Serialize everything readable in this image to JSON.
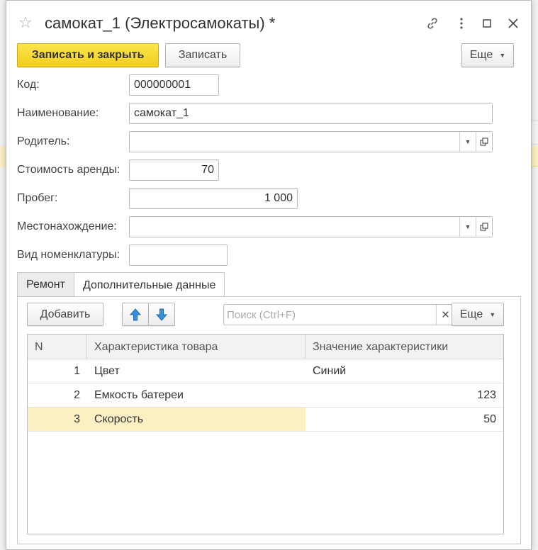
{
  "window": {
    "title": "самокат_1 (Электросамокаты) *"
  },
  "toolbar": {
    "save_close_label": "Записать и закрыть",
    "save_label": "Записать",
    "more_label": "Еще"
  },
  "form": {
    "code_label": "Код:",
    "code_value": "000000001",
    "name_label": "Наименование:",
    "name_value": "самокат_1",
    "parent_label": "Родитель:",
    "parent_value": "",
    "rent_cost_label": "Стоимость аренды:",
    "rent_cost_value": "70",
    "mileage_label": "Пробег:",
    "mileage_value": "1 000",
    "location_label": "Местонахождение:",
    "location_value": "",
    "nomenclature_label": "Вид номенклатуры:",
    "nomenclature_value": ""
  },
  "tabs": [
    {
      "label": "Ремонт",
      "active": false
    },
    {
      "label": "Дополнительные данные",
      "active": true
    }
  ],
  "table_toolbar": {
    "add_label": "Добавить",
    "search_placeholder": "Поиск (Ctrl+F)",
    "more_label": "Еще"
  },
  "table": {
    "columns": [
      "N",
      "Характеристика товара",
      "Значение характеристики"
    ],
    "rows": [
      {
        "n": "1",
        "characteristic": "Цвет",
        "value": "Синий"
      },
      {
        "n": "2",
        "characteristic": "Емкость батереи",
        "value": "123"
      },
      {
        "n": "3",
        "characteristic": "Скорость",
        "value": "50"
      }
    ]
  },
  "colors": {
    "primary_button": "#f2cf1a",
    "selected_row": "#fcefc3",
    "arrow_blue": "#3a8fd9"
  }
}
